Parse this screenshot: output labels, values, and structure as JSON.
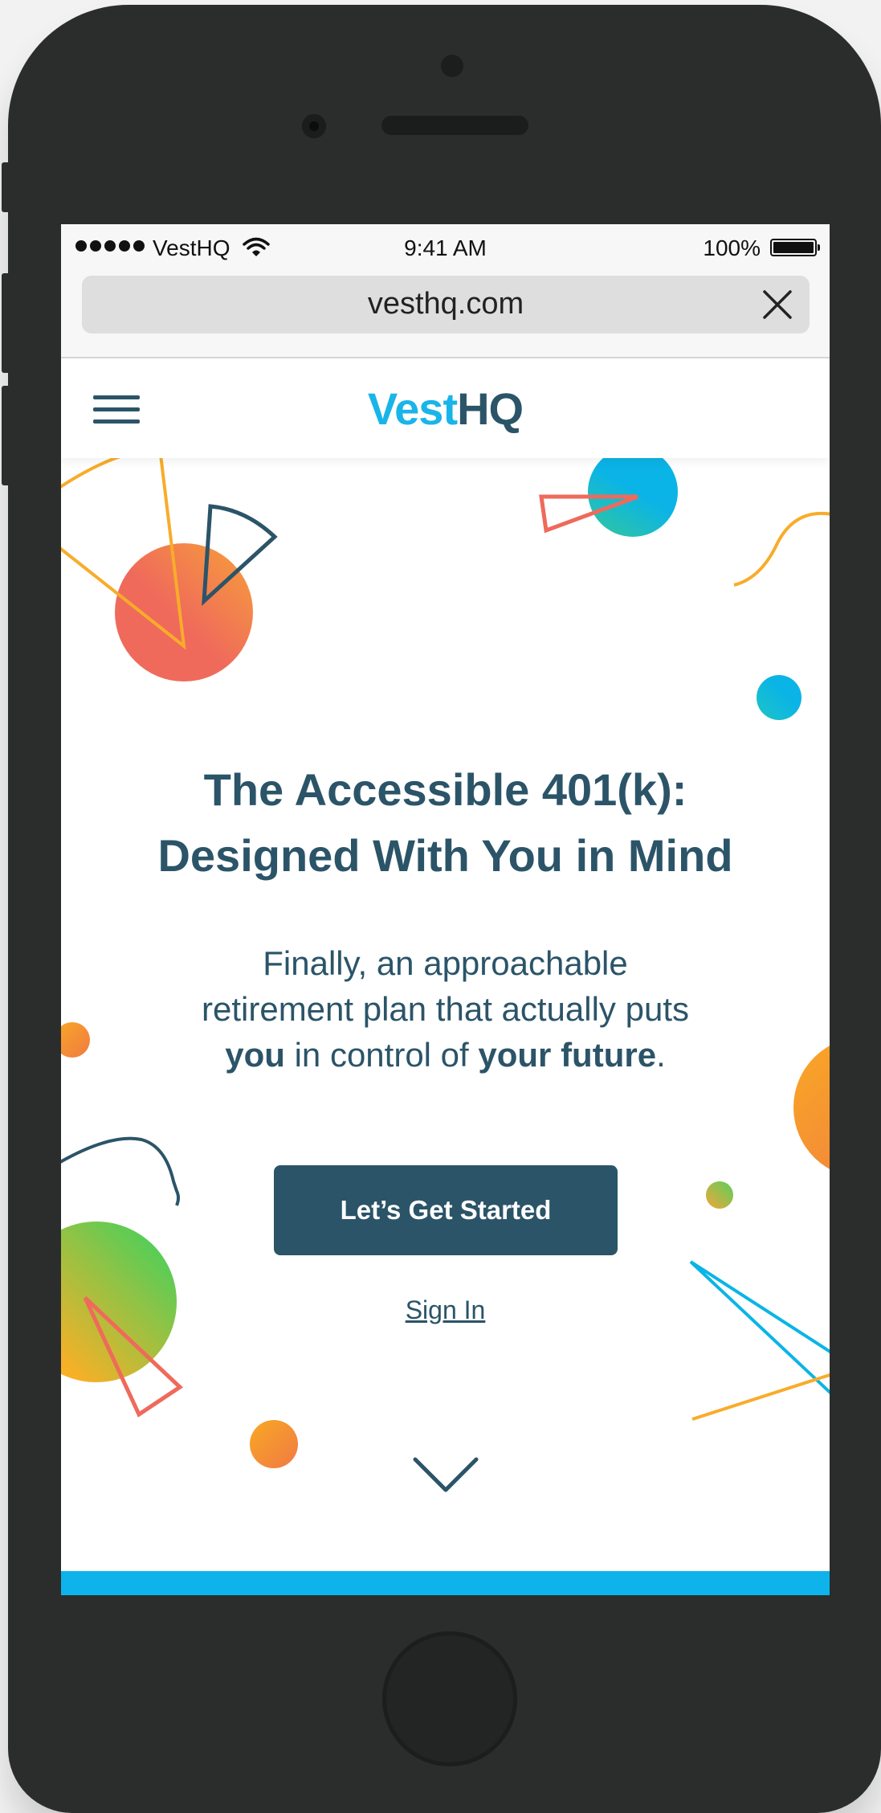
{
  "status_bar": {
    "carrier": "VestHQ",
    "time": "9:41 AM",
    "battery_percent": "100%"
  },
  "browser": {
    "url": "vesthq.com"
  },
  "site": {
    "logo_part1": "Vest",
    "logo_part2": "HQ",
    "logo_colors": {
      "vest": "#19b5e8",
      "hq": "#2b5468"
    }
  },
  "hero": {
    "headline_line1": "The Accessible 401(k):",
    "headline_line2": "Designed With You in Mind",
    "sub_line1": "Finally, an approachable",
    "sub_line2": "retirement plan that actually puts",
    "sub_you": "you",
    "sub_mid": " in control of ",
    "sub_future": "your future",
    "sub_end": ".",
    "cta_label": "Let’s Get Started",
    "signin_label": "Sign In"
  },
  "icons": {
    "menu": "hamburger-icon",
    "close": "close-icon",
    "wifi": "wifi-icon",
    "battery": "battery-icon",
    "scroll": "chevron-down-icon"
  },
  "colors": {
    "primary": "#2b5468",
    "accent": "#0db3ea",
    "phone_body": "#2b2d2d"
  }
}
